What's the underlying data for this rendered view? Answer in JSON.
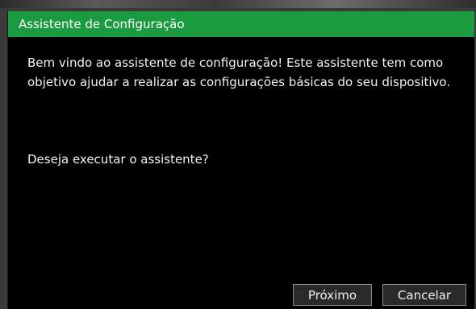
{
  "dialog": {
    "title": "Assistente de Configuração",
    "message": "Bem vindo ao assistente de configuração! Este assistente tem como objetivo ajudar a realizar as configurações básicas do seu dispositivo.",
    "question": "Deseja executar o assistente?",
    "next_label": "Próximo",
    "cancel_label": "Cancelar"
  },
  "colors": {
    "titlebar": "#1b9b3f",
    "background": "#000000",
    "text": "#f2f2f2"
  }
}
